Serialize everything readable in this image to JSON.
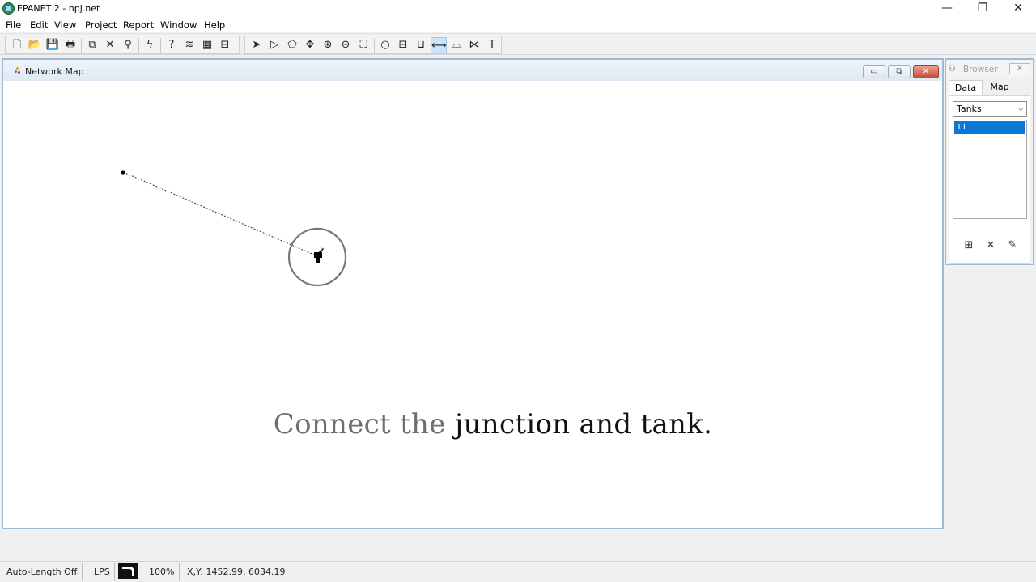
{
  "window": {
    "title": "EPANET 2 - npj.net",
    "controls": {
      "minimize": "—",
      "restore": "❐",
      "close": "✕"
    }
  },
  "menu": [
    "File",
    "Edit",
    "View",
    "Project",
    "Report",
    "Window",
    "Help"
  ],
  "toolbar": {
    "standard": [
      {
        "name": "new-icon",
        "glyph": "🗋"
      },
      {
        "name": "open-icon",
        "glyph": "📂"
      },
      {
        "name": "save-icon",
        "glyph": "💾"
      },
      {
        "name": "print-icon",
        "glyph": "🖶"
      },
      {
        "name": "copy-icon",
        "glyph": "⧉"
      },
      {
        "name": "delete-icon",
        "glyph": "✕"
      },
      {
        "name": "find-icon",
        "glyph": "⚲"
      },
      {
        "name": "run-icon",
        "glyph": "ϟ"
      },
      {
        "name": "query-icon",
        "glyph": "?"
      },
      {
        "name": "graph-icon",
        "glyph": "≋"
      },
      {
        "name": "table-icon",
        "glyph": "▦"
      },
      {
        "name": "options-icon",
        "glyph": "⊟"
      }
    ],
    "map": [
      {
        "name": "select-object-icon",
        "glyph": "➤",
        "active": false
      },
      {
        "name": "select-vertex-icon",
        "glyph": "▷",
        "active": false
      },
      {
        "name": "select-region-icon",
        "glyph": "⬠",
        "active": false
      },
      {
        "name": "pan-icon",
        "glyph": "✥",
        "active": false
      },
      {
        "name": "zoom-in-icon",
        "glyph": "⊕",
        "active": false
      },
      {
        "name": "zoom-out-icon",
        "glyph": "⊖",
        "active": false
      },
      {
        "name": "full-extent-icon",
        "glyph": "⛶",
        "active": false
      },
      {
        "name": "add-junction-icon",
        "glyph": "○",
        "active": false
      },
      {
        "name": "add-reservoir-icon",
        "glyph": "⊟",
        "active": false
      },
      {
        "name": "add-tank-icon",
        "glyph": "⊔",
        "active": false
      },
      {
        "name": "add-pipe-icon",
        "glyph": "⟷",
        "active": true
      },
      {
        "name": "add-pump-icon",
        "glyph": "⌓",
        "active": false
      },
      {
        "name": "add-valve-icon",
        "glyph": "⋈",
        "active": false
      },
      {
        "name": "add-label-icon",
        "glyph": "T",
        "active": false
      }
    ]
  },
  "network_map": {
    "title": "Network Map",
    "controls": {
      "minimize": "▭",
      "restore": "⧉",
      "close": "✕"
    },
    "caption": {
      "grey": "Connect the",
      "dark": "junction and tank."
    }
  },
  "browser": {
    "title": "Browser",
    "icon": "⚇",
    "close": "✕",
    "tabs": [
      "Data",
      "Map"
    ],
    "selected_category": "Tanks",
    "dropdown_arrow": "⌵",
    "items": [
      "T1"
    ],
    "actions": [
      {
        "name": "add-object-icon",
        "glyph": "⊞"
      },
      {
        "name": "delete-object-icon",
        "glyph": "✕"
      },
      {
        "name": "edit-object-icon",
        "glyph": "✎"
      }
    ]
  },
  "status": {
    "auto_length": "Auto-Length Off",
    "flow_units": "LPS",
    "zoom": "100%",
    "coordinates": "X,Y: 1452.99, 6034.19"
  },
  "colors": {
    "accent_selection": "#0a78d7",
    "mdi_border": "#9dbad6",
    "caption_grey": "#6e6e6e",
    "caption_dark": "#111111"
  }
}
